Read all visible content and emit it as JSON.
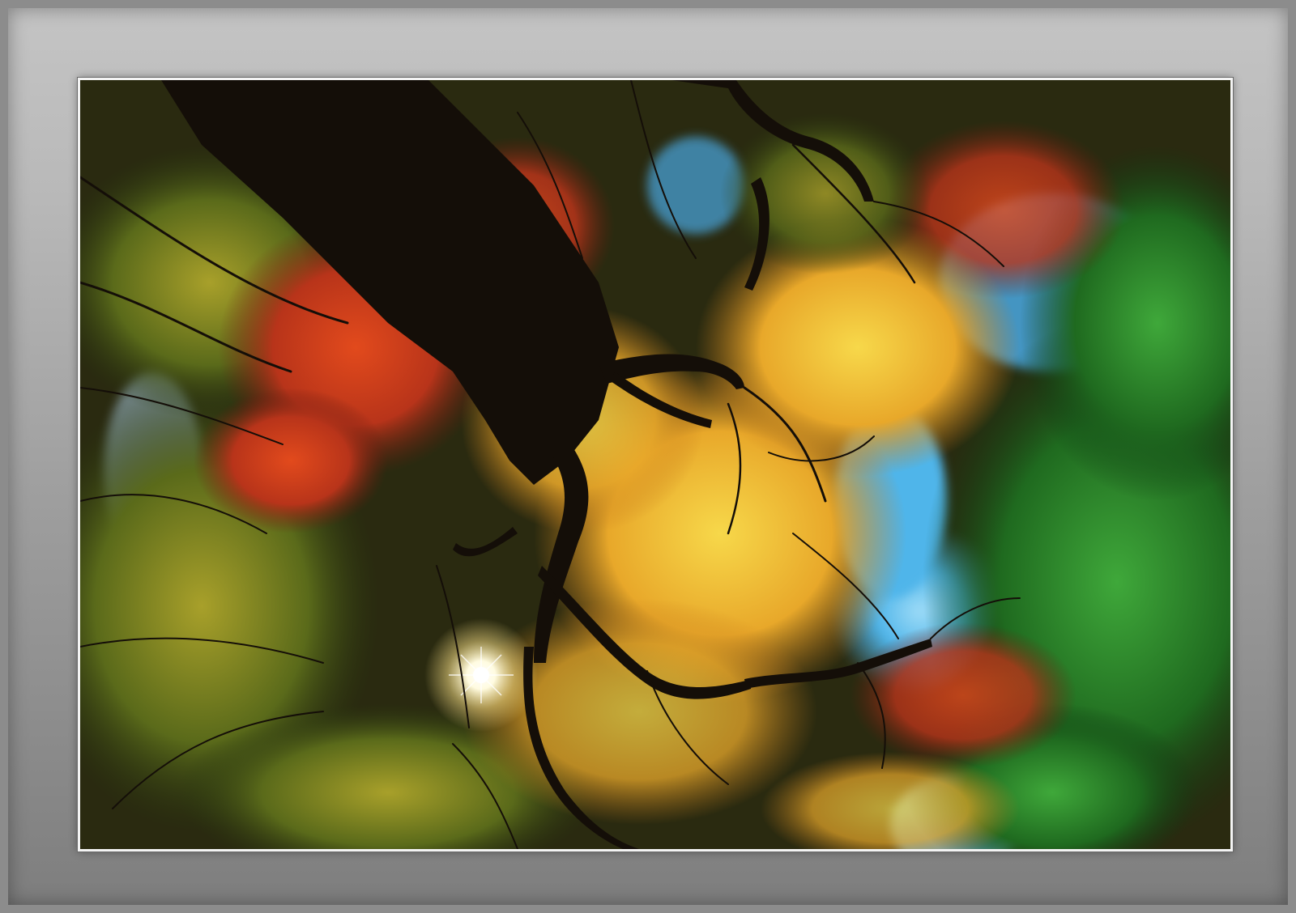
{
  "photo": {
    "subject": "",
    "colors": {
      "sky": "#4fb5ea",
      "sky_light": "#9fdcf7",
      "leaf_orange": "#d9661a",
      "leaf_red": "#b8341a",
      "leaf_gold": "#e8a82a",
      "leaf_yellow": "#f2cf3a",
      "leaf_green": "#2f8a2a",
      "leaf_dark_green": "#0f3a12",
      "trunk": "#140e08",
      "frame_light": "#c4c4c4",
      "frame_dark": "#7e7e7e",
      "mat_border": "#f4f4f4"
    }
  }
}
